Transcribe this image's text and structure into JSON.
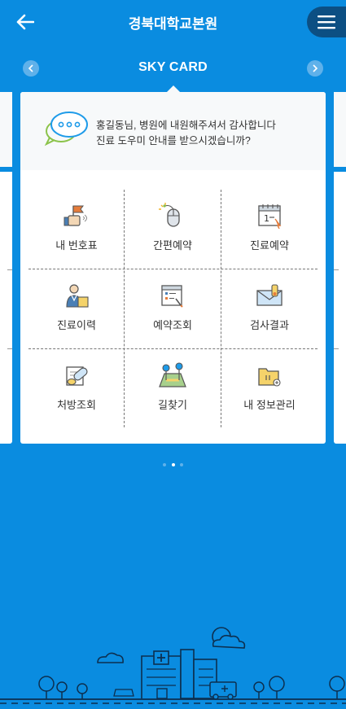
{
  "header": {
    "title": "경북대학교본원"
  },
  "card": {
    "title": "SKY CARD",
    "greeting_line1": "홍길동님, 병원에 내원해주셔서 감사합니다",
    "greeting_line2": "진료 도우미 안내를 받으시겠습니까?"
  },
  "menu": [
    {
      "label": "내 번호표",
      "icon": "ticket-hand-icon"
    },
    {
      "label": "간편예약",
      "icon": "mouse-click-icon"
    },
    {
      "label": "진료예약",
      "icon": "calendar-icon"
    },
    {
      "label": "진료이력",
      "icon": "doctor-history-icon"
    },
    {
      "label": "예약조회",
      "icon": "reservation-search-icon"
    },
    {
      "label": "검사결과",
      "icon": "envelope-result-icon"
    },
    {
      "label": "처방조회",
      "icon": "pill-prescription-icon"
    },
    {
      "label": "길찾기",
      "icon": "map-directions-icon"
    },
    {
      "label": "내 정보관리",
      "icon": "folder-info-icon"
    }
  ],
  "pager": {
    "count": 3,
    "active_index": 1
  },
  "colors": {
    "background": "#0a8ce0",
    "menu_button": "#0c4f83",
    "card": "#ffffff"
  }
}
